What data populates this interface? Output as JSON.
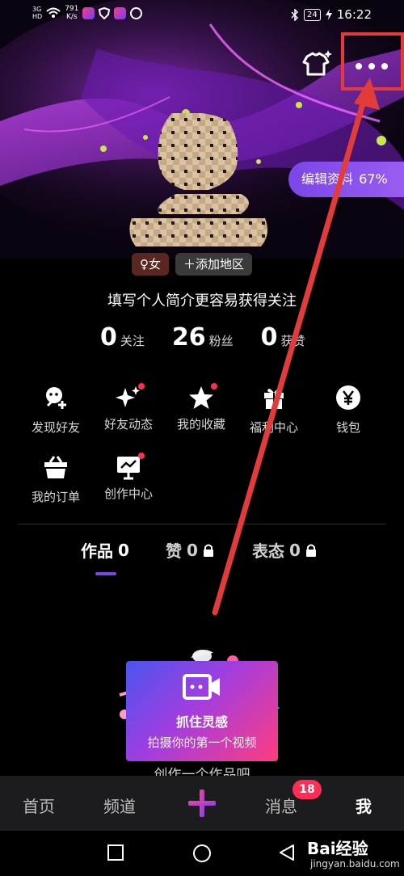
{
  "status_bar": {
    "network": "3G",
    "network_sub": "HD",
    "speed_value": "791",
    "speed_unit": "K/s",
    "battery": "24",
    "time": "16:22"
  },
  "profile": {
    "edit_label": "编辑资料",
    "edit_percent": "67%",
    "gender_tag": "♀女",
    "region_tag": "添加地区",
    "bio_hint": "填写个人简介更容易获得关注"
  },
  "stats": [
    {
      "num": "0",
      "label": "关注"
    },
    {
      "num": "26",
      "label": "粉丝"
    },
    {
      "num": "0",
      "label": "获赞"
    }
  ],
  "shortcuts": [
    {
      "label": "发现好友",
      "icon": "add-friend-icon",
      "dot": false
    },
    {
      "label": "好友动态",
      "icon": "sparkle-icon",
      "dot": true
    },
    {
      "label": "我的收藏",
      "icon": "star-icon",
      "dot": true
    },
    {
      "label": "福利中心",
      "icon": "gift-icon",
      "dot": false
    },
    {
      "label": "钱包",
      "icon": "yen-icon",
      "dot": false
    },
    {
      "label": "我的订单",
      "icon": "basket-icon",
      "dot": false
    },
    {
      "label": "创作中心",
      "icon": "creator-icon",
      "dot": true
    }
  ],
  "tabs": [
    {
      "label": "作品",
      "count": "0",
      "locked": false
    },
    {
      "label": "赞",
      "count": "0",
      "locked": true
    },
    {
      "label": "表态",
      "count": "0",
      "locked": true
    }
  ],
  "promo": {
    "title": "抓住灵感",
    "subtitle": "拍摄你的第一个视频",
    "hint": "创作一个作品吧"
  },
  "bottom_nav": {
    "home": "首页",
    "channel": "频道",
    "messages": "消息",
    "messages_badge": "18",
    "me": "我"
  },
  "watermark": {
    "brand": "Bai经验",
    "site": "jingyan.baidu.com"
  },
  "colors": {
    "accent": "#7b46e8",
    "badge": "#ff2d55",
    "annotation": "#e23b3b"
  }
}
